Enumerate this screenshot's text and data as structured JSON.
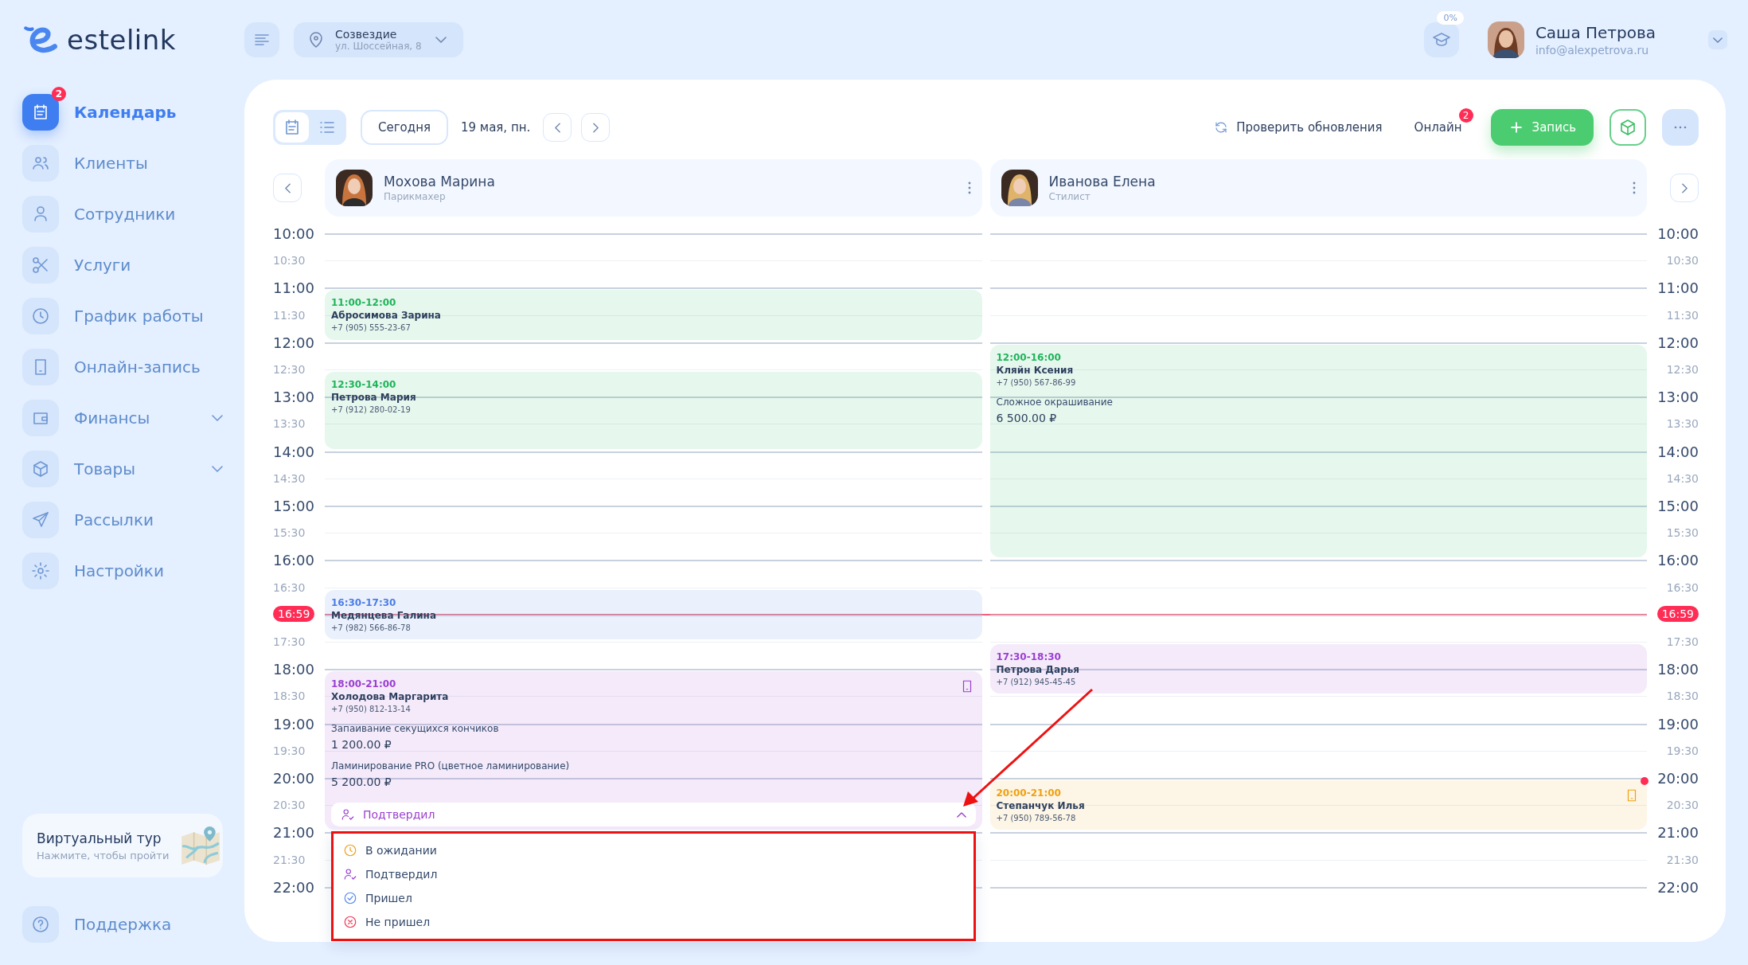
{
  "brand": {
    "name": "estelink"
  },
  "location": {
    "name": "Созвездие",
    "address": "ул. Шоссейная, 8"
  },
  "academy": {
    "progress": "0%"
  },
  "user": {
    "name": "Саша Петрова",
    "email": "info@alexpetrova.ru"
  },
  "sidebar": {
    "items": [
      {
        "label": "Календарь",
        "selected": true,
        "badge": "2"
      },
      {
        "label": "Клиенты",
        "selected": false
      },
      {
        "label": "Сотрудники",
        "selected": false
      },
      {
        "label": "Услуги",
        "selected": false
      },
      {
        "label": "График работы",
        "selected": false
      },
      {
        "label": "Онлайн-запись",
        "selected": false
      },
      {
        "label": "Финансы",
        "selected": false,
        "expandable": true
      },
      {
        "label": "Товары",
        "selected": false,
        "expandable": true
      },
      {
        "label": "Рассылки",
        "selected": false
      },
      {
        "label": "Настройки",
        "selected": false
      }
    ]
  },
  "tour": {
    "title": "Виртуальный тур",
    "subtitle": "Нажмите, чтобы пройти"
  },
  "support": {
    "label": "Поддержка"
  },
  "toolbar": {
    "views": [
      {
        "selected": true
      },
      {
        "selected": false
      }
    ],
    "today": "Сегодня",
    "date": "19 мая, пн.",
    "check_updates": "Проверить обновления",
    "online": {
      "label": "Онлайн",
      "badge": "2"
    },
    "add": "Запись"
  },
  "time_axis": {
    "left": [
      "10:00",
      "10:30",
      "11:00",
      "11:30",
      "12:00",
      "12:30",
      "13:00",
      "13:30",
      "14:00",
      "14:30",
      "15:00",
      "15:30",
      "16:00",
      "16:30",
      "17:30",
      "18:00",
      "18:30",
      "19:00",
      "19:30",
      "20:00",
      "20:30",
      "21:00",
      "21:30",
      "22:00"
    ],
    "right": [
      "10:00",
      "10:30",
      "11:00",
      "11:30",
      "12:00",
      "12:30",
      "13:00",
      "13:30",
      "14:00",
      "14:30",
      "15:00",
      "15:30",
      "16:00",
      "16:30",
      "17:30",
      "18:00",
      "18:30",
      "19:00",
      "19:30",
      "20:00",
      "20:30",
      "21:00",
      "21:30",
      "22:00"
    ]
  },
  "now": {
    "left": "16:59",
    "right": "16:59"
  },
  "staff": [
    {
      "name": "Мохова Марина",
      "role": "Парикмахер",
      "appointments": [
        {
          "time": "11:00-12:00",
          "client": "Абросимова Зарина",
          "phone": "+7 (905) 555-23-67",
          "color": "#1fb45a"
        },
        {
          "time": "12:30-14:00",
          "client": "Петрова Мария",
          "phone": "+7 (912) 280-02-19",
          "color": "#1fb45a"
        },
        {
          "time": "16:30-17:30",
          "client": "Медянцева Галина",
          "phone": "+7 (982) 566-86-78",
          "color": "#4a7de8"
        },
        {
          "time": "18:00-21:00",
          "client": "Холодова Маргарита",
          "phone": "+7 (950) 812-13-14",
          "color": "#9b3fd0",
          "online": true,
          "services": [
            {
              "name": "Запаивание секущихся кончиков",
              "price": "1 200.00 ₽"
            },
            {
              "name": "Ламинирование PRO (цветное ламинирование)",
              "price": "5 200.00 ₽"
            }
          ],
          "status": {
            "label": "Подтвердил",
            "kind": "confirmed",
            "expanded": true,
            "options": [
              {
                "label": "В ожидании",
                "kind": "pending"
              },
              {
                "label": "Подтвердил",
                "kind": "confirmed"
              },
              {
                "label": "Пришел",
                "kind": "arrived"
              },
              {
                "label": "Не пришел",
                "kind": "no_show"
              }
            ]
          }
        }
      ]
    },
    {
      "name": "Иванова Елена",
      "role": "Стилист",
      "appointments": [
        {
          "time": "12:00-16:00",
          "client": "Кляйн Ксения",
          "phone": "+7 (950) 567-86-99",
          "color": "#1fb45a",
          "services": [
            {
              "name": "Сложное окрашивание",
              "price": "6 500.00 ₽"
            }
          ]
        },
        {
          "time": "17:30-18:30",
          "client": "Петрова Дарья",
          "phone": "+7 (912) 945-45-45",
          "color": "#9b3fd0"
        },
        {
          "time": "20:00-21:00",
          "client": "Степанчук Илья",
          "phone": "+7 (950) 789-56-78",
          "color": "#f0a010",
          "online": true,
          "alert": true
        }
      ]
    }
  ]
}
